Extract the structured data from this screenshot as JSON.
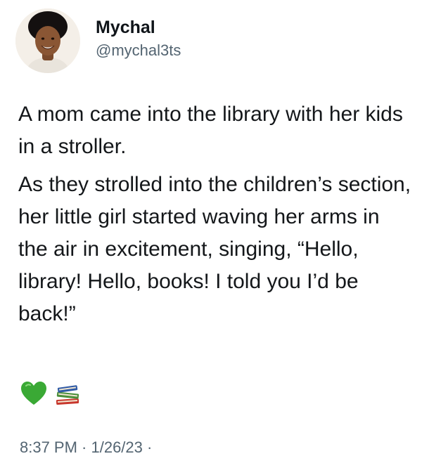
{
  "author": {
    "display_name": "Mychal",
    "handle": "@mychal3ts"
  },
  "tweet": {
    "paragraphs": [
      "A mom came into the library with her kids in a stroller.",
      "As they strolled into the children’s section, her little girl started waving her arms in the air in excitement, singing, “Hello, library! Hello, books! I told you I’d be back!”"
    ],
    "emojis": [
      "green-heart-icon",
      "books-icon"
    ],
    "timestamp": "8:37 PM · 1/26/23 ·"
  },
  "colors": {
    "text": "#14171a",
    "secondary": "#536471",
    "heart": "#3aa935"
  }
}
